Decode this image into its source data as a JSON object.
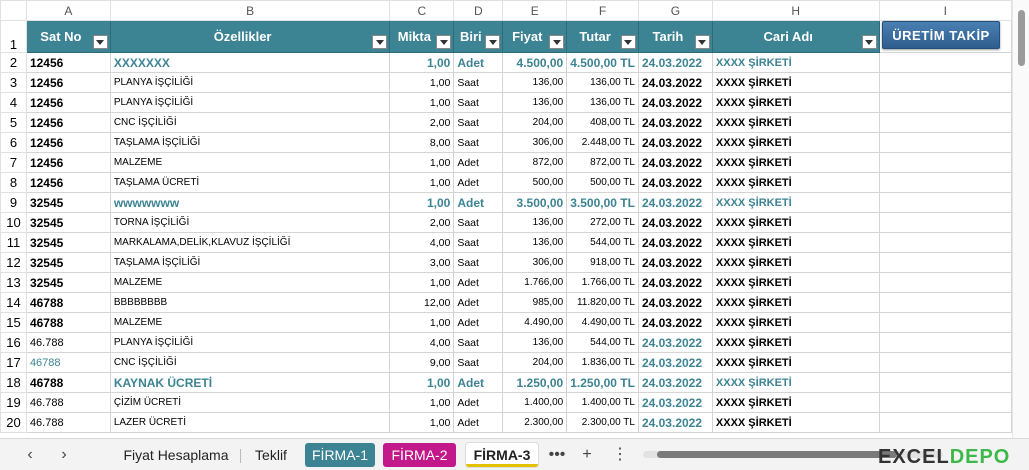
{
  "columns": [
    "A",
    "B",
    "C",
    "D",
    "E",
    "F",
    "G",
    "H",
    "I"
  ],
  "headers": {
    "sat_no": "Sat No",
    "ozellikler": "Özellikler",
    "miktar": "Mikta",
    "birim": "Biri",
    "fiyat": "Fiyat",
    "tutar": "Tutar",
    "tarih": "Tarih",
    "cari_adi": "Cari Adı"
  },
  "button": {
    "label": "ÜRETİM TAKİP"
  },
  "rows": [
    {
      "n": "2",
      "a": "12456",
      "b": "XXXXXXX",
      "c": "1,00",
      "d": "Adet",
      "e": "4.500,00",
      "f": "4.500,00 TL",
      "g": "24.03.2022",
      "h": "XXXX ŞİRKETİ",
      "group": true
    },
    {
      "n": "3",
      "a": "12456",
      "b": "PLANYA İŞÇİLİĞİ",
      "c": "1,00",
      "d": "Saat",
      "e": "136,00",
      "f": "136,00 TL",
      "g": "24.03.2022",
      "h": "XXXX ŞİRKETİ"
    },
    {
      "n": "4",
      "a": "12456",
      "b": "PLANYA İŞÇİLİĞİ",
      "c": "1,00",
      "d": "Saat",
      "e": "136,00",
      "f": "136,00 TL",
      "g": "24.03.2022",
      "h": "XXXX ŞİRKETİ"
    },
    {
      "n": "5",
      "a": "12456",
      "b": "CNC İŞÇİLİĞİ",
      "c": "2,00",
      "d": "Saat",
      "e": "204,00",
      "f": "408,00 TL",
      "g": "24.03.2022",
      "h": "XXXX ŞİRKETİ"
    },
    {
      "n": "6",
      "a": "12456",
      "b": "TAŞLAMA İŞÇİLİĞİ",
      "c": "8,00",
      "d": "Saat",
      "e": "306,00",
      "f": "2.448,00 TL",
      "g": "24.03.2022",
      "h": "XXXX ŞİRKETİ"
    },
    {
      "n": "7",
      "a": "12456",
      "b": "MALZEME",
      "c": "1,00",
      "d": "Adet",
      "e": "872,00",
      "f": "872,00 TL",
      "g": "24.03.2022",
      "h": "XXXX ŞİRKETİ"
    },
    {
      "n": "8",
      "a": "12456",
      "b": "TAŞLAMA ÜCRETİ",
      "c": "1,00",
      "d": "Adet",
      "e": "500,00",
      "f": "500,00 TL",
      "g": "24.03.2022",
      "h": "XXXX ŞİRKETİ"
    },
    {
      "n": "9",
      "a": "32545",
      "b": "wwwwwww",
      "c": "1,00",
      "d": "Adet",
      "e": "3.500,00",
      "f": "3.500,00 TL",
      "g": "24.03.2022",
      "h": "XXXX ŞİRKETİ",
      "group": true
    },
    {
      "n": "10",
      "a": "32545",
      "b": "TORNA İŞÇİLİĞİ",
      "c": "2,00",
      "d": "Saat",
      "e": "136,00",
      "f": "272,00 TL",
      "g": "24.03.2022",
      "h": "XXXX ŞİRKETİ"
    },
    {
      "n": "11",
      "a": "32545",
      "b": "MARKALAMA,DELİK,KLAVUZ İŞÇİLİĞİ",
      "c": "4,00",
      "d": "Saat",
      "e": "136,00",
      "f": "544,00 TL",
      "g": "24.03.2022",
      "h": "XXXX ŞİRKETİ"
    },
    {
      "n": "12",
      "a": "32545",
      "b": "TAŞLAMA İŞÇİLİĞİ",
      "c": "3,00",
      "d": "Saat",
      "e": "306,00",
      "f": "918,00 TL",
      "g": "24.03.2022",
      "h": "XXXX ŞİRKETİ"
    },
    {
      "n": "13",
      "a": "32545",
      "b": "MALZEME",
      "c": "1,00",
      "d": "Adet",
      "e": "1.766,00",
      "f": "1.766,00 TL",
      "g": "24.03.2022",
      "h": "XXXX ŞİRKETİ"
    },
    {
      "n": "14",
      "a": "46788",
      "b": "BBBBBBBB",
      "c": "12,00",
      "d": "Adet",
      "e": "985,00",
      "f": "11.820,00 TL",
      "g": "24.03.2022",
      "h": "XXXX ŞİRKETİ"
    },
    {
      "n": "15",
      "a": "46788",
      "b": "MALZEME",
      "c": "1,00",
      "d": "Adet",
      "e": "4.490,00",
      "f": "4.490,00 TL",
      "g": "24.03.2022",
      "h": "XXXX ŞİRKETİ"
    },
    {
      "n": "16",
      "a": "46.788",
      "b": "PLANYA İŞÇİLİĞİ",
      "c": "4,00",
      "d": "Saat",
      "e": "136,00",
      "f": "544,00 TL",
      "g": "24.03.2022",
      "h": "XXXX ŞİRKETİ",
      "astyle": "plain",
      "gteal": true
    },
    {
      "n": "17",
      "a": "46788",
      "b": "CNC İŞÇİLİĞİ",
      "c": "9,00",
      "d": "Saat",
      "e": "204,00",
      "f": "1.836,00 TL",
      "g": "24.03.2022",
      "h": "XXXX ŞİRKETİ",
      "astyle": "plain2",
      "gteal": true
    },
    {
      "n": "18",
      "a": "46788",
      "b": "KAYNAK ÜCRETİ",
      "c": "1,00",
      "d": "Adet",
      "e": "1.250,00",
      "f": "1.250,00 TL",
      "g": "24.03.2022",
      "h": "XXXX ŞİRKETİ",
      "group": true
    },
    {
      "n": "19",
      "a": "46.788",
      "b": "ÇİZİM ÜCRETİ",
      "c": "1,00",
      "d": "Adet",
      "e": "1.400,00",
      "f": "1.400,00 TL",
      "g": "24.03.2022",
      "h": "XXXX ŞİRKETİ",
      "astyle": "plain",
      "gteal": true
    },
    {
      "n": "20",
      "a": "46.788",
      "b": "LAZER ÜCRETİ",
      "c": "1,00",
      "d": "Adet",
      "e": "2.300,00",
      "f": "2.300,00 TL",
      "g": "24.03.2022",
      "h": "XXXX ŞİRKETİ",
      "astyle": "plain",
      "gteal": true
    }
  ],
  "tabs": [
    {
      "label": "Fiyat Hesaplama"
    },
    {
      "label": "Teklif"
    },
    {
      "label": "FİRMA-1"
    },
    {
      "label": "FİRMA-2"
    },
    {
      "label": "FİRMA-3"
    }
  ],
  "tab_more": "•••",
  "tab_add": "+",
  "tab_prev": "‹",
  "tab_next": "›",
  "tab_menu": "⋮",
  "logo": {
    "part1": "EXCEL",
    "part2": "DEPO"
  },
  "colors": {
    "header_teal": "#3c8393",
    "firma1": "#3c8393",
    "firma2": "#c2188a",
    "button": "#2e5e8e"
  }
}
